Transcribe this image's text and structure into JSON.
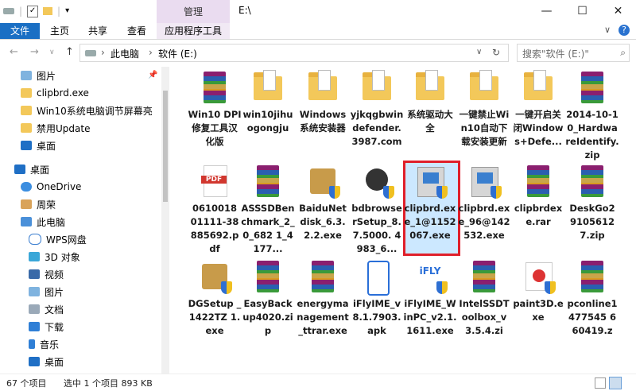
{
  "titlebar": {
    "context_tab": "管理",
    "title": "E:\\",
    "minimize": "—",
    "maximize": "☐",
    "close": "✕"
  },
  "ribbon": {
    "tabs": [
      "文件",
      "主页",
      "共享",
      "查看",
      "应用程序工具"
    ],
    "expand": "∨",
    "help": "?"
  },
  "addressbar": {
    "back": "←",
    "forward": "→",
    "recent": "∨",
    "up": "↑",
    "crumbs": [
      "此电脑",
      "软件 (E:)"
    ],
    "sep": "›",
    "dropdown": "∨",
    "refresh": "↻",
    "search_placeholder": "搜索\"软件 (E:)\"",
    "search_icon": "⌕"
  },
  "sidebar": {
    "quick_access": [
      {
        "label": "图片",
        "icon": "pictures-icon",
        "pin": "📌"
      },
      {
        "label": "clipbrd.exe",
        "icon": "folder-icon"
      },
      {
        "label": "Win10系统电脑调节屏幕亮",
        "icon": "folder-icon"
      },
      {
        "label": "禁用Update",
        "icon": "folder-icon"
      },
      {
        "label": "桌面",
        "icon": "desktop-icon"
      }
    ],
    "desktop": {
      "label": "桌面",
      "icon": "desktop-icon"
    },
    "tree": [
      {
        "label": "OneDrive",
        "icon": "onedrive-icon"
      },
      {
        "label": "周荣",
        "icon": "user-icon"
      },
      {
        "label": "此电脑",
        "icon": "computer-icon"
      },
      {
        "label": "WPS网盘",
        "icon": "cloud-icon"
      },
      {
        "label": "3D 对象",
        "icon": "3d-objects-icon"
      },
      {
        "label": "视频",
        "icon": "video-icon"
      },
      {
        "label": "图片",
        "icon": "pictures-icon"
      },
      {
        "label": "文档",
        "icon": "documents-icon"
      },
      {
        "label": "下载",
        "icon": "downloads-icon"
      },
      {
        "label": "音乐",
        "icon": "music-icon"
      },
      {
        "label": "桌面",
        "icon": "desktop-icon"
      }
    ]
  },
  "files": [
    {
      "label": "Win10 DPI修复工具汉化版",
      "icon": "rar-archive-icon"
    },
    {
      "label": "win10jihuogongju",
      "icon": "folder-icon"
    },
    {
      "label": "Windows系统安装器",
      "icon": "folder-icon"
    },
    {
      "label": "yjkqgbwindefender.3987.com",
      "icon": "folder-icon"
    },
    {
      "label": "系统驱动大全",
      "icon": "folder-icon"
    },
    {
      "label": "一键禁止Win10自动下载安装更新",
      "icon": "folder-icon"
    },
    {
      "label": "一键开启关闭Windows+Defe...",
      "icon": "folder-icon"
    },
    {
      "label": "2014-10-10_HardwareIdentify.zip",
      "icon": "rar-archive-icon"
    },
    {
      "label": "0610018 01111-38 885692.p df",
      "icon": "pdf-icon"
    },
    {
      "label": "ASSSDBenchmark_2_0_682 1_4177...",
      "icon": "rar-archive-icon"
    },
    {
      "label": "BaiduNetdisk_6.3.2.2.exe",
      "icon": "installer-box-icon"
    },
    {
      "label": "bdbrowserSetup_8.7.5000. 4983_6...",
      "icon": "browser-setup-icon"
    },
    {
      "label": "clipbrd.exe_1@1152067.exe",
      "icon": "installer-icon"
    },
    {
      "label": "clipbrd.exe_96@142532.exe",
      "icon": "installer-icon"
    },
    {
      "label": "clipbrdexe.rar",
      "icon": "rar-archive-icon"
    },
    {
      "label": "DeskGo2 91056127.zip",
      "icon": "rar-archive-icon"
    },
    {
      "label": "DGSetup _1422TZ 1.exe",
      "icon": "installer-box-icon"
    },
    {
      "label": "EasyBackup4020.zip",
      "icon": "rar-archive-icon"
    },
    {
      "label": "energymanagement_ttrar.exe",
      "icon": "winrar-sfx-icon"
    },
    {
      "label": "iFlyIME_v8.1.7903.apk",
      "icon": "apk-icon"
    },
    {
      "label": "iFlyIME_WinPC_v2.1.1611.exe",
      "icon": "ifly-icon"
    },
    {
      "label": "IntelSSDToolbox_v3.5.4.zi",
      "icon": "rar-archive-icon"
    },
    {
      "label": "paint3D.exe",
      "icon": "paint-installer-icon"
    },
    {
      "label": "pconline1477545 660419.z",
      "icon": "rar-archive-icon"
    }
  ],
  "status": {
    "count": "67 个项目",
    "selection": "选中 1 个项目 893 KB"
  }
}
